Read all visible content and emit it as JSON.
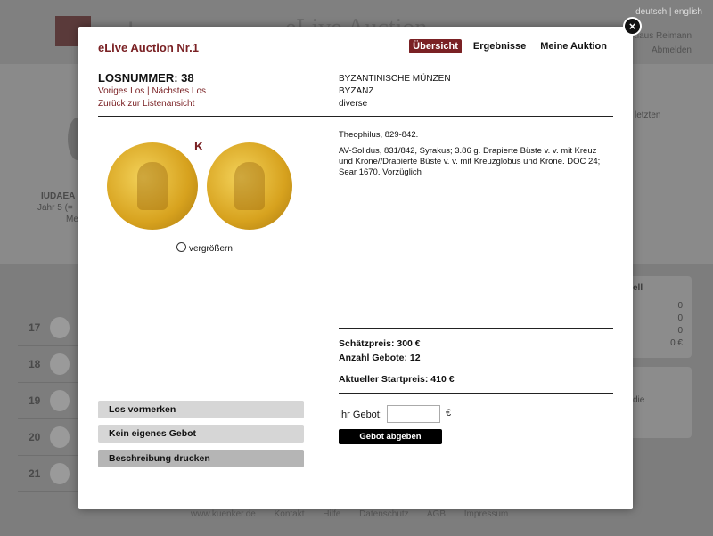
{
  "background": {
    "logo_text": "unker",
    "title": "eLive Auction",
    "lang": "deutsch | english",
    "user_name": "Klaus Reimann",
    "logout": "Abmelden",
    "coin_title": "IUDAEA",
    "coin_sub1": "Jahr 5 (=",
    "coin_sub2": "Me",
    "right_text": "letzten",
    "panel_title": "ell",
    "panel_values": [
      "0",
      "0",
      "0",
      "0 €"
    ],
    "panel2_text": "die",
    "rows": [
      "17",
      "18",
      "19",
      "20",
      "21"
    ],
    "footer": "www.kuenker.de Kontakt Hilfe Datenschutz AGB Impressum"
  },
  "modal": {
    "title": "eLive Auction Nr.1",
    "tabs": [
      {
        "label": "Übersicht",
        "active": true
      },
      {
        "label": "Ergebnisse",
        "active": false
      },
      {
        "label": "Meine Auktion",
        "active": false
      }
    ],
    "lot_number": "LOSNUMMER: 38",
    "prev_lot": "Voriges Los",
    "separator": "|",
    "next_lot": "Nächstes Los",
    "back_to_list": "Zurück zur Listenansicht",
    "category1": "BYZANTINISCHE MÜNZEN",
    "category2": "BYZANZ",
    "category3": "diverse",
    "zoom_label": "vergrößern",
    "coin_mark": "K",
    "ruler": "Theophilus, 829-842.",
    "description": "AV-Solidus, 831/842, Syrakus; 3.86 g. Drapierte Büste v. v. mit Kreuz und Krone//Drapierte Büste v. v. mit Kreuzglobus und Krone. DOC 24; Sear 1670. Vorzüglich",
    "estimate": "Schätzpreis: 300 €",
    "bids_count": "Anzahl Gebote: 12",
    "start_price": "Aktueller Startpreis: 410 €",
    "bid_label": "Ihr Gebot:",
    "bid_value": "",
    "currency": "€",
    "submit": "Gebot abgeben",
    "buttons": {
      "watch": "Los vormerken",
      "no_bid": "Kein eigenes Gebot",
      "print": "Beschreibung drucken"
    },
    "close": "×"
  }
}
